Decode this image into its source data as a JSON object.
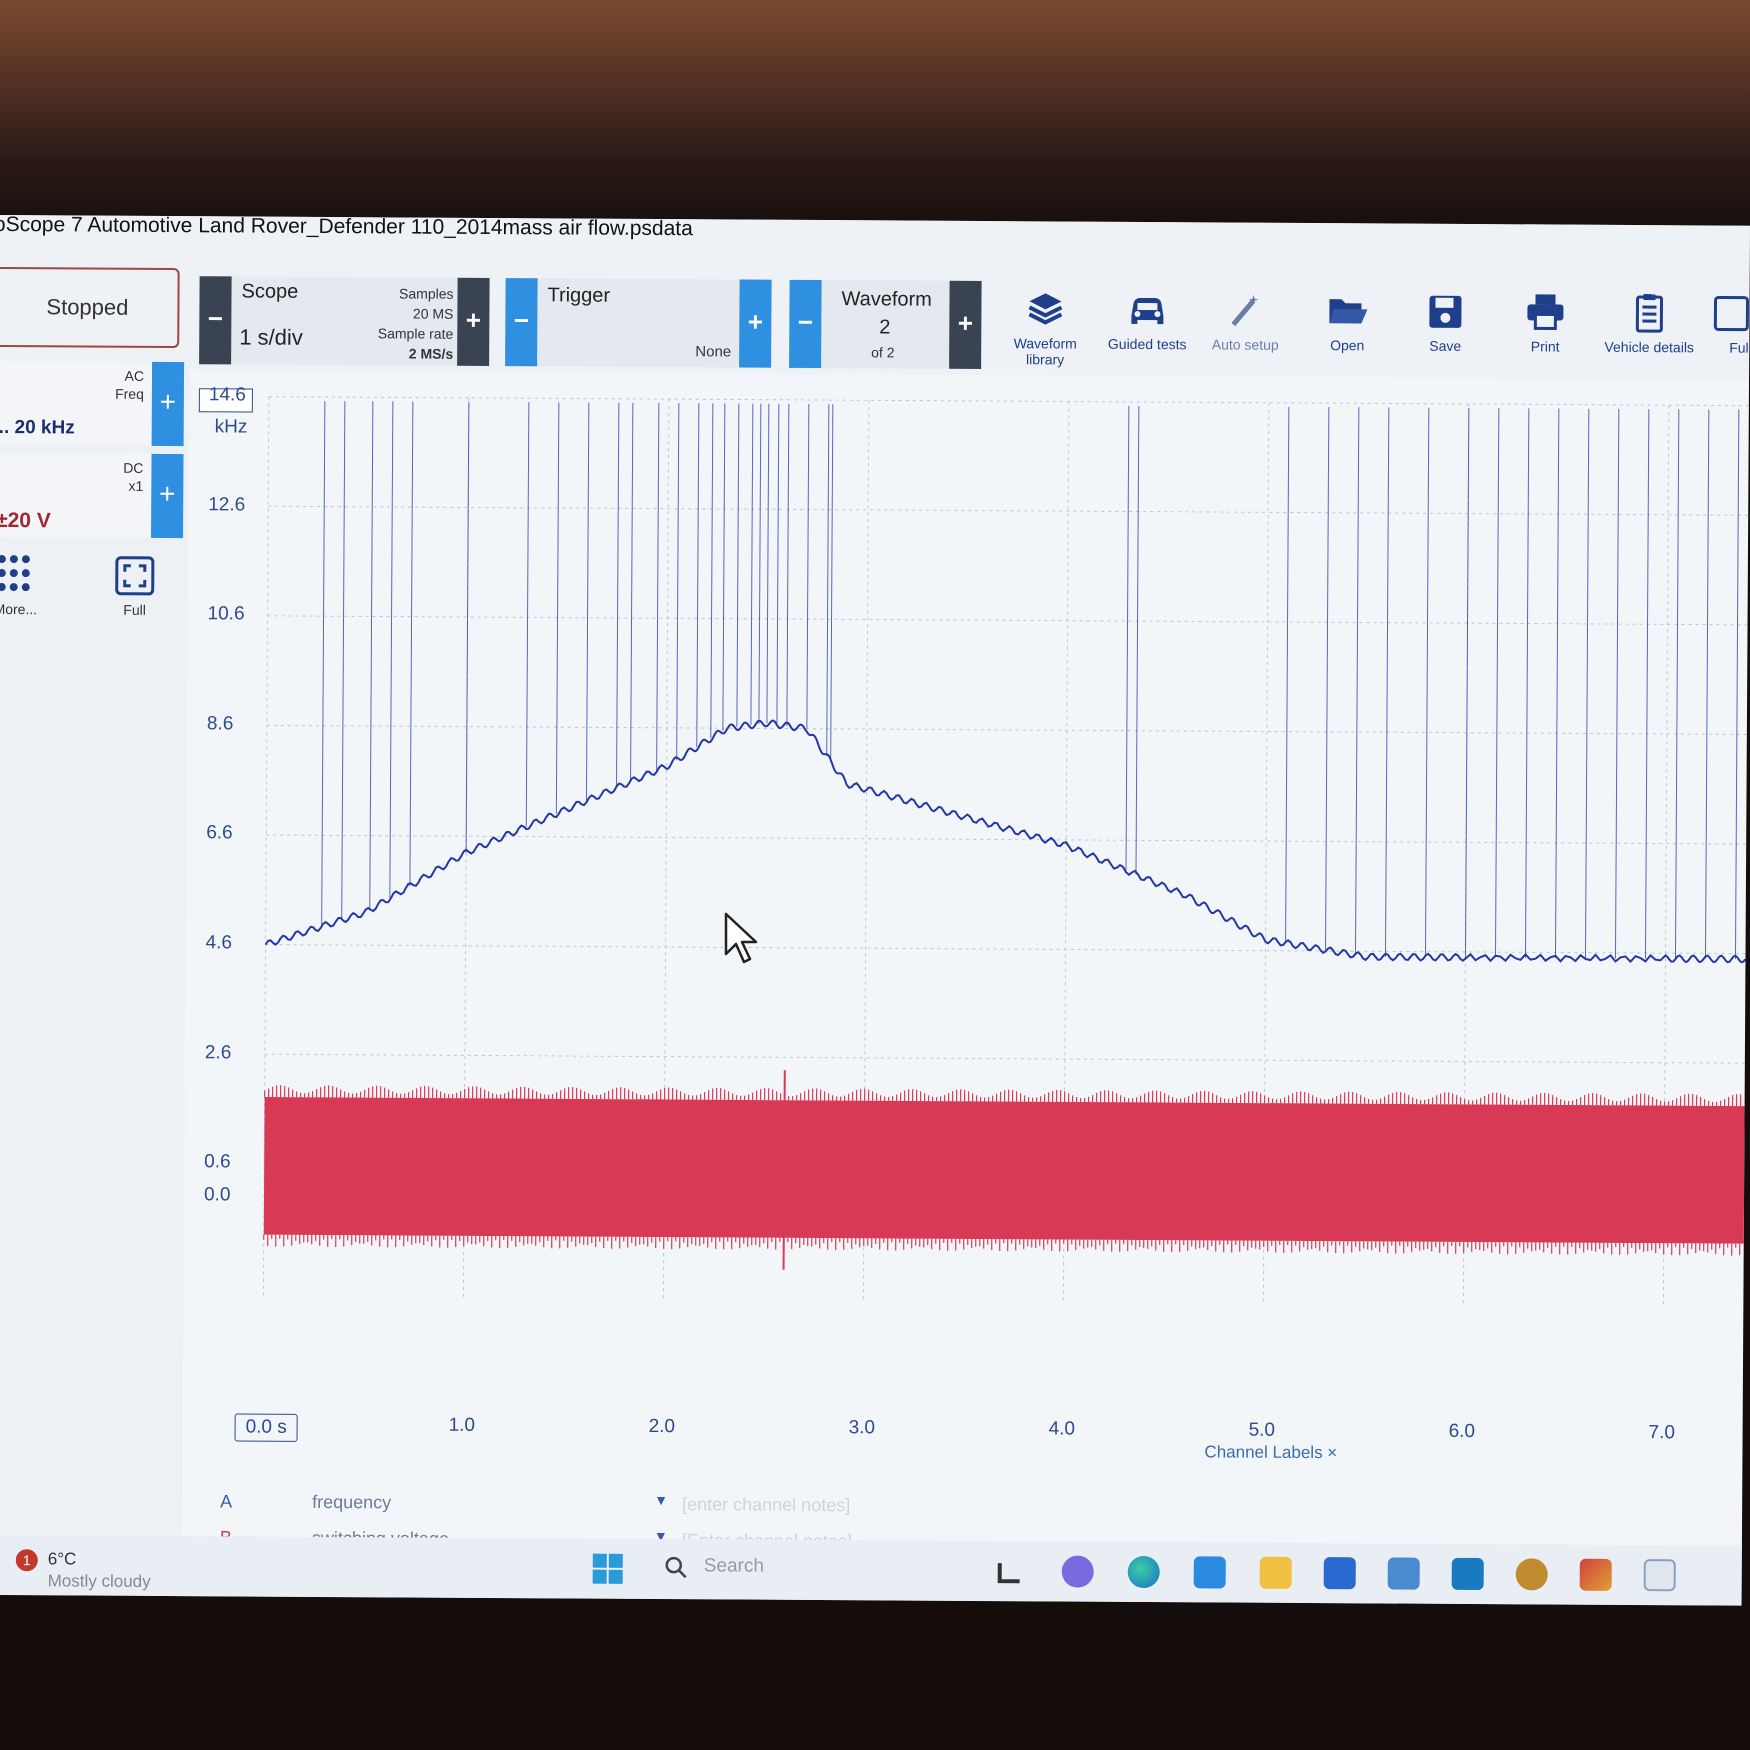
{
  "window": {
    "title": "oScope 7 Automotive Land Rover_Defender 110_2014mass air flow.psdata"
  },
  "status": {
    "run_state": "Stopped"
  },
  "toolbar": {
    "scope": {
      "label": "Scope",
      "timebase": "1 s/div",
      "samples_label": "Samples",
      "samples_value": "20 MS",
      "rate_label": "Sample rate",
      "rate_value": "2 MS/s"
    },
    "trigger": {
      "label": "Trigger",
      "mode": "None"
    },
    "waveform": {
      "label": "Waveform",
      "index": "2",
      "of": "of 2"
    },
    "tools": [
      {
        "label": "Waveform library",
        "icon": "books-icon"
      },
      {
        "label": "Guided tests",
        "icon": "car-icon"
      },
      {
        "label": "Auto setup",
        "icon": "wand-icon"
      },
      {
        "label": "Open",
        "icon": "folder-icon"
      },
      {
        "label": "Save",
        "icon": "floppy-icon"
      },
      {
        "label": "Print",
        "icon": "printer-icon"
      },
      {
        "label": "Vehicle details",
        "icon": "clipboard-icon"
      },
      {
        "label": "Ful",
        "icon": "fullscreen-icon"
      }
    ]
  },
  "channels": {
    "a": {
      "coupling": "AC",
      "mode": "Freq",
      "range": ".. 20 kHz"
    },
    "b": {
      "coupling": "DC",
      "probe": "x1",
      "range": "±20 V"
    },
    "more_label": "More...",
    "full_label": "Full"
  },
  "plot": {
    "y_ticks": [
      "14.6",
      "12.6",
      "10.6",
      "8.6",
      "6.6",
      "4.6",
      "2.6",
      "0.6",
      "0.0"
    ],
    "y_unit": "kHz",
    "x_ticks": [
      "0.0 s",
      "1.0",
      "2.0",
      "3.0",
      "4.0",
      "5.0",
      "6.0",
      "7.0"
    ],
    "channel_labels_button": "Channel Labels ×"
  },
  "channel_notes": [
    {
      "ch": "A",
      "name": "frequency",
      "placeholder": "[enter channel notes]"
    },
    {
      "ch": "B",
      "name": "switching voltage",
      "placeholder": "[Enter channel notes]"
    }
  ],
  "taskbar": {
    "weather_temp": "6°C",
    "weather_desc": "Mostly cloudy",
    "weather_badge": "1",
    "search_label": "Search"
  },
  "colors": {
    "channel_a": "#2536a8",
    "channel_b": "#d83a55",
    "accent_blue": "#2f8fe0",
    "dark_button": "#3a4352"
  },
  "chart_data": {
    "type": "line",
    "x_unit": "s",
    "series": [
      {
        "name": "A",
        "x": [
          0.0,
          0.5,
          1.0,
          1.5,
          2.0,
          2.3,
          2.5,
          2.7,
          2.9,
          3.4,
          4.0,
          4.6,
          5.0,
          5.5,
          6.0,
          7.0,
          7.4
        ],
        "values": [
          4.6,
          5.2,
          6.3,
          7.1,
          7.9,
          8.6,
          8.7,
          8.6,
          7.6,
          7.1,
          6.5,
          5.6,
          4.8,
          4.5,
          4.5,
          4.5,
          4.5
        ]
      },
      {
        "name": "B",
        "x": [
          0.0,
          7.4
        ],
        "values": [
          0.0,
          2.0
        ]
      }
    ],
    "ylim": [
      0.0,
      14.6
    ],
    "xlim": [
      0.0,
      7.4
    ]
  }
}
